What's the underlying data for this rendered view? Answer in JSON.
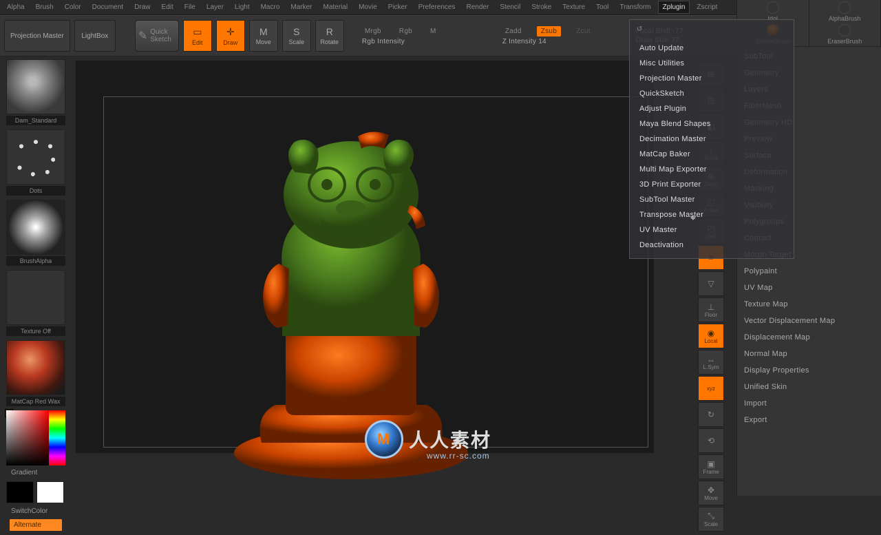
{
  "menubar": [
    "Alpha",
    "Brush",
    "Color",
    "Document",
    "Draw",
    "Edit",
    "File",
    "Layer",
    "Light",
    "Macro",
    "Marker",
    "Material",
    "Movie",
    "Picker",
    "Preferences",
    "Render",
    "Stencil",
    "Stroke",
    "Texture",
    "Tool",
    "Transform",
    "Zplugin",
    "Zscript"
  ],
  "menubar_active": "Zplugin",
  "topbar": {
    "projection": "Projection Master",
    "lightbox": "LightBox",
    "quicksketch": "Quick Sketch",
    "edit": "Edit",
    "draw": "Draw",
    "move": "Move",
    "scale": "Scale",
    "rotate": "Rotate",
    "modes_row1": [
      "Mrgb",
      "Rgb",
      "M"
    ],
    "modes_row2_label": "Rgb Intensity",
    "z_row": [
      "Zadd",
      "Zsub",
      "Zcut"
    ],
    "z_active": "Zsub",
    "z_intensity": "Z Intensity 14",
    "focal": "Focal Shift -77",
    "drawsize": "Draw Size 37"
  },
  "left": {
    "t1": "Dam_Standard",
    "t2": "Dots",
    "t3": "BrushAlpha",
    "t4": "Texture Off",
    "t5": "MatCap Red Wax",
    "gradient": "Gradient",
    "switch": "SwitchColor",
    "alternate": "Alternate"
  },
  "zplugin_menu": [
    "Auto Update",
    "Misc Utilities",
    "Projection Master",
    "QuickSketch",
    "Adjust Plugin",
    "Maya Blend Shapes",
    "Decimation Master",
    "MatCap Baker",
    "Multi Map Exporter",
    "3D Print Exporter",
    "SubTool Master",
    "Transpose Master",
    "UV Master",
    "Deactivation"
  ],
  "right_shelf": [
    {
      "label": "",
      "icon": "⊞"
    },
    {
      "label": "",
      "icon": "⊡"
    },
    {
      "label": "",
      "icon": "◧"
    },
    {
      "label": "Scroll",
      "icon": "↕"
    },
    {
      "label": "Zoom",
      "icon": "⊕"
    },
    {
      "label": "Actual",
      "icon": "◱"
    },
    {
      "label": "Half",
      "icon": "◰"
    },
    {
      "label": "",
      "icon": "≡",
      "active": true
    },
    {
      "label": "",
      "icon": "▽"
    },
    {
      "label": "Floor",
      "icon": "⊥"
    },
    {
      "label": "Local",
      "icon": "◉",
      "active": true
    },
    {
      "label": "L.Sym",
      "icon": "↔"
    },
    {
      "label": "xyz",
      "icon": "",
      "active": true
    },
    {
      "label": "",
      "icon": "↻"
    },
    {
      "label": "",
      "icon": "⟲"
    },
    {
      "label": "Frame",
      "icon": "▣"
    },
    {
      "label": "Move",
      "icon": "✥"
    },
    {
      "label": "Scale",
      "icon": "⤡"
    }
  ],
  "fr_top": [
    {
      "label": "Idol",
      "icon": "flat"
    },
    {
      "label": "AlphaBrush",
      "icon": "flat"
    },
    {
      "label": "SimpleBrush",
      "icon": "ball"
    },
    {
      "label": "EraserBrush",
      "icon": "flat"
    }
  ],
  "fr_panel": [
    "SubTool",
    "Geometry",
    "Layers",
    "FiberMesh",
    "Geometry HD",
    "Preview",
    "Surface",
    "Deformation",
    "Masking",
    "Visibility",
    "Polygroups",
    "Contact",
    "Morph Target",
    "Polypaint",
    "UV Map",
    "Texture Map",
    "Vector Displacement Map",
    "Displacement Map",
    "Normal Map",
    "Display Properties",
    "Unified Skin",
    "Import",
    "Export"
  ],
  "watermark": {
    "text": "人人素材",
    "url": "www.rr-sc.com"
  }
}
